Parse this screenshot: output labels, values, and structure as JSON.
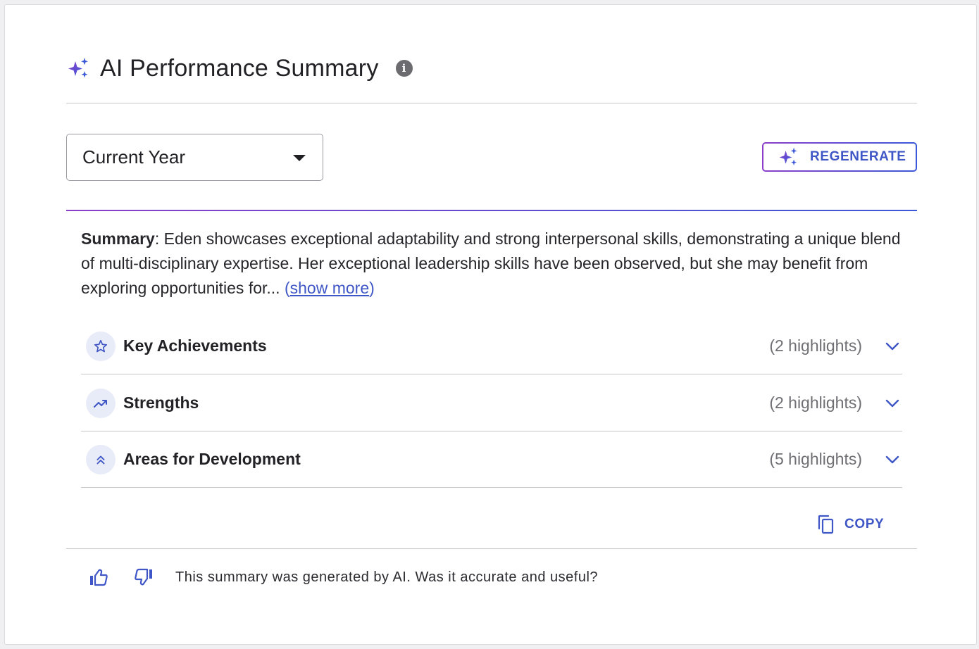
{
  "header": {
    "title": "AI Performance Summary",
    "info_icon": "info-icon"
  },
  "period_select": {
    "value": "Current Year"
  },
  "regenerate": {
    "label": "REGENERATE"
  },
  "summary": {
    "lead": "Summary",
    "text": ": Eden showcases exceptional adaptability and strong interpersonal skills, demonstrating a unique blend of multi-disciplinary expertise. Her exceptional leadership skills have been observed, but she may benefit from exploring opportunities for... ",
    "show_more": "show more"
  },
  "sections": [
    {
      "label": "Key Achievements",
      "count": "(2 highlights)",
      "icon": "star-icon"
    },
    {
      "label": "Strengths",
      "count": "(2 highlights)",
      "icon": "trending-up-icon"
    },
    {
      "label": "Areas for Development",
      "count": "(5 highlights)",
      "icon": "double-chevron-up-icon"
    }
  ],
  "copy": {
    "label": "COPY"
  },
  "feedback": {
    "text": "This summary was generated by AI. Was it accurate and useful?"
  },
  "colors": {
    "accent": "#3f56c6",
    "gradient_start": "#8b3fc9",
    "gradient_end": "#3b58d8",
    "icon_bg": "#e8ebf8"
  }
}
